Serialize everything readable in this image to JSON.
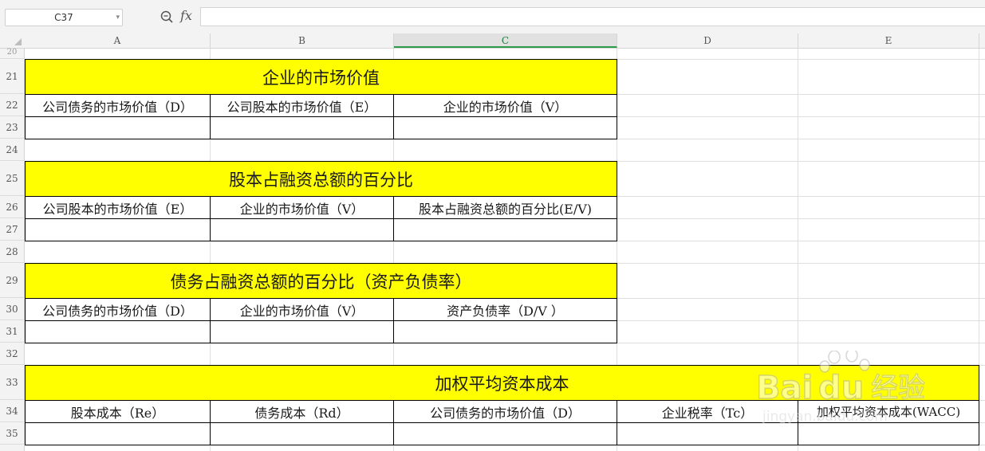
{
  "formula_bar": {
    "name_box": "C37",
    "fx_label": "fx",
    "formula": ""
  },
  "columns": [
    {
      "letter": "A",
      "selected": false
    },
    {
      "letter": "B",
      "selected": false
    },
    {
      "letter": "C",
      "selected": true
    },
    {
      "letter": "D",
      "selected": false
    },
    {
      "letter": "E",
      "selected": false
    }
  ],
  "rows": [
    "20",
    "21",
    "22",
    "23",
    "24",
    "25",
    "26",
    "27",
    "28",
    "29",
    "30",
    "31",
    "32",
    "33",
    "34",
    "35"
  ],
  "tables": [
    {
      "title": "企业的市场价值",
      "headers": [
        "公司债务的市场价值（D）",
        "公司股本的市场价值（E）",
        "企业的市场价值（V）"
      ]
    },
    {
      "title": "股本占融资总额的百分比",
      "headers": [
        "公司股本的市场价值（E）",
        "企业的市场价值（V）",
        "股本占融资总额的百分比(E/V)"
      ]
    },
    {
      "title": "债务占融资总额的百分比（资产负债率）",
      "headers": [
        "公司债务的市场价值（D）",
        "企业的市场价值（V）",
        "资产负债率（D/V ）"
      ]
    },
    {
      "title": "加权平均资本成本",
      "headers": [
        "股本成本（Re）",
        "债务成本（Rd）",
        "公司债务的市场价值（D）",
        "企业税率（Tc）",
        "加权平均资本成本(WACC)"
      ]
    }
  ],
  "watermark": {
    "brand": "Bai",
    "brand2": "du",
    "cn": "经验",
    "url": "jingyan.baidu.com"
  },
  "colors": {
    "title_fill": "#ffff00",
    "selected_col_accent": "#2f9a4c"
  }
}
